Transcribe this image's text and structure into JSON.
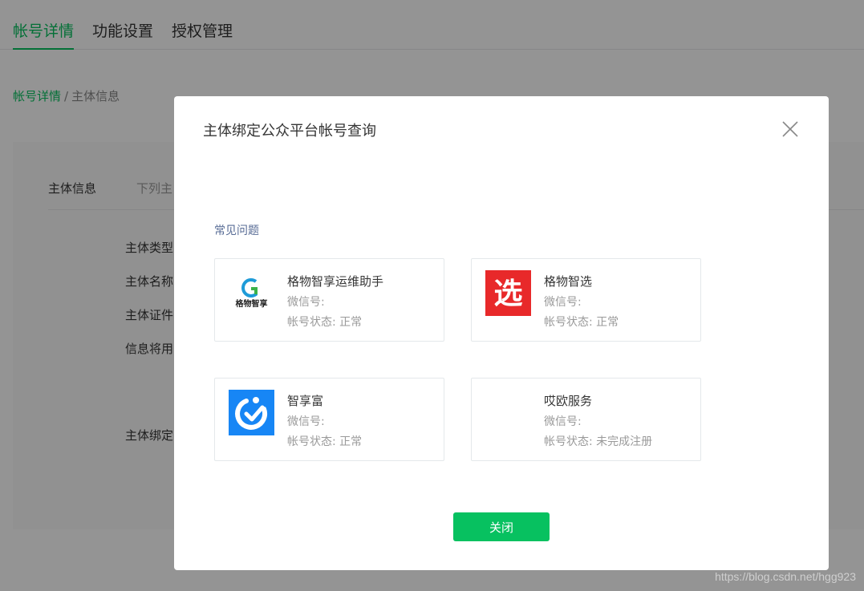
{
  "top_tabs": [
    {
      "label": "帐号详情"
    },
    {
      "label": "功能设置"
    },
    {
      "label": "授权管理"
    }
  ],
  "breadcrumb": {
    "link": "帐号详情",
    "separator": "/",
    "current": "主体信息"
  },
  "card": {
    "tabs": [
      {
        "label": "主体信息"
      },
      {
        "label": "下列主"
      }
    ],
    "fields": [
      {
        "label": "主体类型"
      },
      {
        "label": "主体名称"
      },
      {
        "label": "主体证件"
      },
      {
        "label": "信息将用"
      },
      {
        "label": "主体绑定"
      }
    ]
  },
  "dialog": {
    "title": "主体绑定公众平台帐号查询",
    "faq_link": "常见问题",
    "accounts": [
      {
        "name": "格物智享运维助手",
        "wechat_id": "微信号:",
        "status": "帐号状态: 正常",
        "logo_text": "格物智享",
        "logo_icon": "g-letter-icon"
      },
      {
        "name": "格物智选",
        "wechat_id": "微信号:",
        "status": "帐号状态: 正常",
        "logo_text": "选",
        "logo_color": "#e8292a"
      },
      {
        "name": "智享富",
        "wechat_id": "微信号:",
        "status": "帐号状态: 正常",
        "logo_icon": "circular-arrow-icon",
        "logo_color": "#1786f5"
      },
      {
        "name": "哎欧服务",
        "wechat_id": "微信号:",
        "status": "帐号状态: 未完成注册"
      }
    ],
    "close_button": "关闭"
  },
  "watermark": "https://blog.csdn.net/hgg923",
  "colors": {
    "accent": "#07c160",
    "link": "#576b95",
    "overlay": "rgba(0,0,0,0.42)"
  }
}
